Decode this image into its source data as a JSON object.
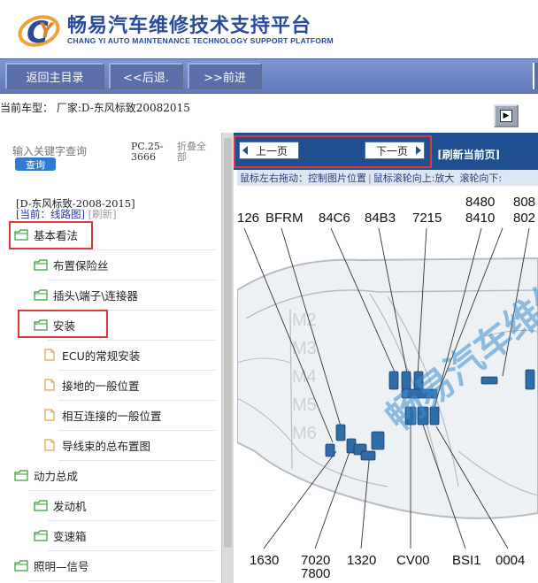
{
  "app": {
    "title": "畅易汽车维修技术支持平台",
    "subtitle": "CHANG YI AUTO MAINTENANCE TECHNOLOGY SUPPORT PLATFORM"
  },
  "nav": {
    "home_label": "返回主目录",
    "back_label": "<<后退.",
    "forward_label": ">>前进"
  },
  "vehicle": {
    "label": "当前车型：  厂家:D-东风标致20082015"
  },
  "search": {
    "placeholder": "输入关键字查询",
    "button_label": "查询",
    "pc_code": "PC.25-3666",
    "collapse_all": "折叠全部"
  },
  "tree": {
    "vehicle_line": "[D-东风标致-2008-2015]",
    "current_prefix": "[当前：线路图]",
    "refresh_label": "[刷新]",
    "items": [
      {
        "label": "基本看法",
        "type": "folder"
      },
      {
        "label": "布置保险丝",
        "type": "folder"
      },
      {
        "label": "插头\\端子\\连接器",
        "type": "folder"
      },
      {
        "label": "安装",
        "type": "folder"
      },
      {
        "label": "ECU的常规安装",
        "type": "doc"
      },
      {
        "label": "接地的一般位置",
        "type": "doc"
      },
      {
        "label": "相互连接的一般位置",
        "type": "doc"
      },
      {
        "label": "导线束的总布置图",
        "type": "doc"
      },
      {
        "label": "动力总成",
        "type": "folder"
      },
      {
        "label": "发动机",
        "type": "folder"
      },
      {
        "label": "变速箱",
        "type": "folder"
      },
      {
        "label": "照明—信号",
        "type": "folder"
      }
    ]
  },
  "pager": {
    "prev_label": "上一页",
    "next_label": "下一页",
    "refresh_label": "[刷新当前页]",
    "hint_drag": "鼠标左右拖动：控制图片位置",
    "hint_zoom": "鼠标滚轮向上:放大",
    "hint_zoom_down": "滚轮向下:"
  },
  "diagram": {
    "top_labels": [
      "126",
      "BFRM",
      "84C6",
      "84B3",
      "7215"
    ],
    "top_right_labels": [
      "8480",
      "8410",
      "808",
      "802"
    ],
    "bottom_labels": [
      "1630",
      "7020",
      "7800",
      "1320",
      "CV00",
      "BSI1",
      "0004"
    ],
    "zone_labels": [
      "M2",
      "M3",
      "M4",
      "M5",
      "M6"
    ],
    "watermark": "畅易汽车维修"
  },
  "colors": {
    "brand": "#2a4a9a",
    "navbar": "#6b84c4",
    "pager": "#1f4f8f",
    "highlight": "#d93a3a",
    "component": "#2f6da8"
  }
}
